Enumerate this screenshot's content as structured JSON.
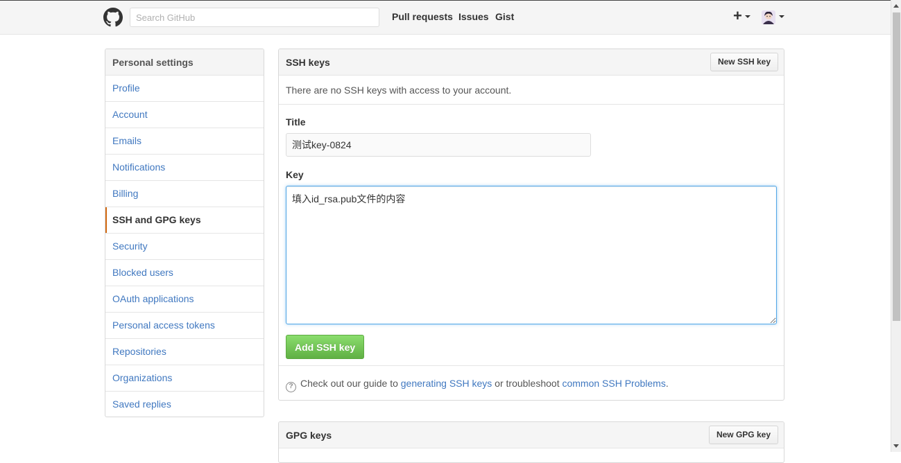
{
  "header": {
    "search_placeholder": "Search GitHub",
    "nav": [
      "Pull requests",
      "Issues",
      "Gist"
    ],
    "plus_label": "+"
  },
  "sidebar": {
    "title": "Personal settings",
    "items": [
      {
        "label": "Profile"
      },
      {
        "label": "Account"
      },
      {
        "label": "Emails"
      },
      {
        "label": "Notifications"
      },
      {
        "label": "Billing"
      },
      {
        "label": "SSH and GPG keys",
        "selected": true
      },
      {
        "label": "Security"
      },
      {
        "label": "Blocked users"
      },
      {
        "label": "OAuth applications"
      },
      {
        "label": "Personal access tokens"
      },
      {
        "label": "Repositories"
      },
      {
        "label": "Organizations"
      },
      {
        "label": "Saved replies"
      }
    ]
  },
  "ssh_panel": {
    "title": "SSH keys",
    "new_button": "New SSH key",
    "empty_message": "There are no SSH keys with access to your account.",
    "title_label": "Title",
    "title_value": "测试key-0824",
    "key_label": "Key",
    "key_value": "填入id_rsa.pub文件的内容",
    "add_button": "Add SSH key",
    "help": {
      "icon": "?",
      "prefix": "Check out our guide to ",
      "link1": "generating SSH keys",
      "middle": " or troubleshoot ",
      "link2": "common SSH Problems",
      "suffix": "."
    }
  },
  "gpg_panel": {
    "title": "GPG keys",
    "new_button": "New GPG key"
  },
  "colors": {
    "link": "#4078c0",
    "selected_accent": "#d26911",
    "primary_button": "#60b044",
    "focus_border": "#51a7e8"
  },
  "icons": {
    "logo": "github-octocat-icon",
    "plus": "plus-icon",
    "caret": "chevron-down-icon",
    "help": "question-circle-icon"
  }
}
